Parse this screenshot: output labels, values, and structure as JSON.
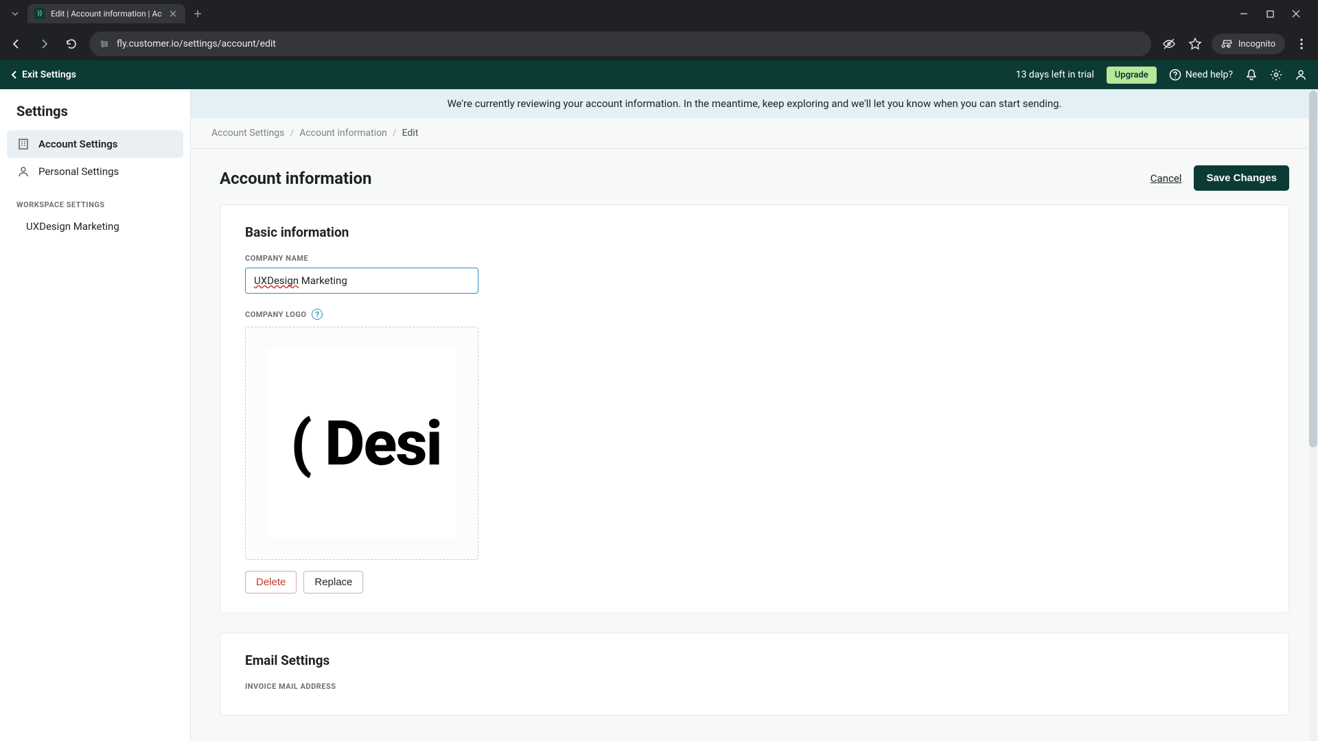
{
  "browser": {
    "tab_title": "Edit | Account information | Ac",
    "url": "fly.customer.io/settings/account/edit",
    "incognito": "Incognito"
  },
  "topbar": {
    "exit": "Exit Settings",
    "trial": "13 days left in trial",
    "upgrade": "Upgrade",
    "help": "Need help?"
  },
  "sidebar": {
    "title": "Settings",
    "account": "Account Settings",
    "personal": "Personal Settings",
    "workspace_label": "WORKSPACE SETTINGS",
    "workspace_name": "UXDesign Marketing"
  },
  "banner": "We're currently reviewing your account information. In the meantime, keep exploring and we'll let you know when you can start sending.",
  "breadcrumb": {
    "a": "Account Settings",
    "b": "Account information",
    "c": "Edit"
  },
  "page": {
    "title": "Account information",
    "cancel": "Cancel",
    "save": "Save Changes"
  },
  "basic": {
    "title": "Basic information",
    "company_name_label": "COMPANY NAME",
    "company_name_value_prefix": "UXDesign",
    "company_name_value_suffix": " Marketing",
    "company_logo_label": "COMPANY LOGO",
    "logo_text": "( Desi",
    "delete": "Delete",
    "replace": "Replace"
  },
  "email": {
    "title": "Email Settings",
    "invoice_label": "INVOICE MAIL ADDRESS"
  }
}
